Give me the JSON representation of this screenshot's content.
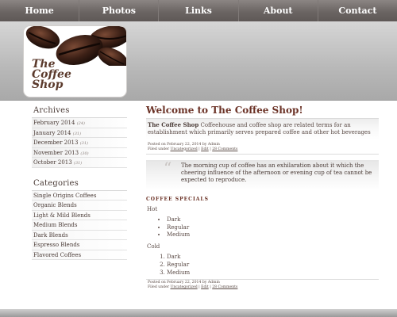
{
  "nav": {
    "items": [
      "Home",
      "Photos",
      "Links",
      "About",
      "Contact"
    ]
  },
  "logo": {
    "line1": "The",
    "line2": "Coffee",
    "line3": "Shop"
  },
  "sidebar": {
    "archives_title": "Archives",
    "archives": [
      {
        "label": "February 2014",
        "count": "(24)"
      },
      {
        "label": "January 2014",
        "count": "(31)"
      },
      {
        "label": "December 2013",
        "count": "(31)"
      },
      {
        "label": "November 2013",
        "count": "(30)"
      },
      {
        "label": "October 2013",
        "count": "(31)"
      }
    ],
    "categories_title": "Categories",
    "categories": [
      "Single Origins Coffees",
      "Organic Blends",
      "Light & Mild Blends",
      "Medium Blends",
      "Dark Blends",
      "Espresso Blends",
      "Flavored Coffees"
    ]
  },
  "main": {
    "title": "Welcome to The Coffee Shop!",
    "intro_bold": "The Coffee Shop",
    "intro_text": " Coffeehouse and coffee shop are related terms for an establishment which primarily serves prepared coffee and other hot beverages",
    "meta1": {
      "line1": "Posted on February 22, 2014 by Admin",
      "filed": "Filed under ",
      "category": "Uncategorized",
      "sep1": " | ",
      "edit": "Edit",
      "sep2": " | ",
      "comments": "28 Comments"
    },
    "quote": "The morning cup of coffee has an exhilaration about it which the cheering influence of the afternoon or evening cup of tea cannot be expected to reproduce.",
    "specials_heading": "COFFEE SPECIALS",
    "hot_label": "Hot",
    "hot_items": [
      "Dark",
      "Regular",
      "Medium"
    ],
    "cold_label": "Cold",
    "cold_items": [
      "Dark",
      "Regular",
      "Medium"
    ],
    "meta2": {
      "line1": "Posted on February 22, 2014 by Admin",
      "filed": "Filed under ",
      "category": "Uncategorized",
      "sep1": " | ",
      "edit": "Edit",
      "sep2": " | ",
      "comments": "28 Comments"
    }
  }
}
